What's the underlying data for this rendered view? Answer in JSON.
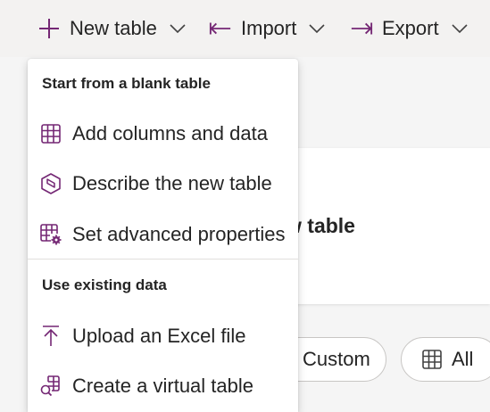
{
  "commandbar": {
    "new_table": {
      "label": "New table",
      "icon": "plus-icon"
    },
    "import": {
      "label": "Import",
      "icon": "import-arrow-icon"
    },
    "export": {
      "label": "Export",
      "icon": "export-arrow-icon"
    }
  },
  "background": {
    "card_title": "w table",
    "filters": {
      "custom": "Custom",
      "all": {
        "label": "All",
        "icon": "table-grid-icon"
      }
    }
  },
  "menu": {
    "section1": {
      "header": "Start from a blank table",
      "items": [
        {
          "label": "Add columns and data",
          "icon": "table-grid-icon"
        },
        {
          "label": "Describe the new table",
          "icon": "copilot-icon"
        },
        {
          "label": "Set advanced properties",
          "icon": "table-settings-icon"
        }
      ]
    },
    "section2": {
      "header": "Use existing data",
      "items": [
        {
          "label": "Upload an Excel file",
          "icon": "upload-arrow-icon"
        },
        {
          "label": "Create a virtual table",
          "icon": "virtual-table-icon"
        }
      ]
    }
  },
  "colors": {
    "accent_icon": "#742774",
    "text": "#242424",
    "background": "#f3f2f1"
  }
}
